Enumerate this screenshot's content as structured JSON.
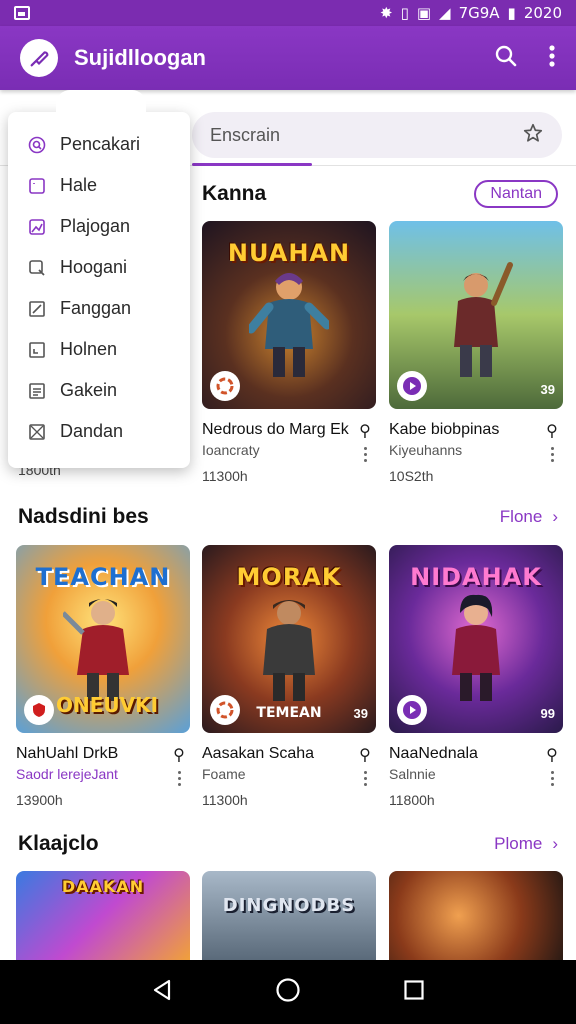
{
  "status_bar": {
    "signal_text": "7G9A",
    "time": "2020"
  },
  "app_bar": {
    "title": "Sujidlloogan",
    "search_icon": "search-icon",
    "menu_icon": "more-vert-icon",
    "logo_icon": "pen-nib-icon"
  },
  "search": {
    "placeholder": "Enscrain",
    "action_icon": "star-icon"
  },
  "dropdown": {
    "items": [
      {
        "label": "Pencakari",
        "icon": "search-circle-icon"
      },
      {
        "label": "Hale",
        "icon": "square-icon"
      },
      {
        "label": "Plajogan",
        "icon": "image-edit-icon"
      },
      {
        "label": "Hoogani",
        "icon": "search-icon"
      },
      {
        "label": "Fanggan",
        "icon": "edit-square-icon"
      },
      {
        "label": "Holnen",
        "icon": "layout-icon"
      },
      {
        "label": "Gakein",
        "icon": "document-icon"
      },
      {
        "label": "Dandan",
        "icon": "crossed-box-icon"
      }
    ]
  },
  "section1": {
    "title": "Kanna",
    "button": "Nantan",
    "cards": [
      {
        "art_title": "NUAHAN",
        "name": "Nedrous do Marg Ek",
        "sub": "Ioancraty",
        "time": "11300h",
        "count": "",
        "badge": "spin-icon"
      },
      {
        "art_title": "",
        "name": "Kabe biobpinas",
        "sub": "Kiyeuhanns",
        "time": "10S2th",
        "count": "39",
        "badge": "play-icon"
      }
    ],
    "hidden_card_time": "1800th"
  },
  "section2": {
    "title": "Nadsdini bes",
    "link": "Flone",
    "cards": [
      {
        "art_title": "TEACHAN",
        "name": "NahUahl DrkB",
        "sub": "Saodr lerejeJant",
        "sub_accent": true,
        "time": "13900h",
        "count": "",
        "badge": "shield-icon",
        "bottom_label": "ONEUVKI"
      },
      {
        "art_title": "MORAK",
        "name": "Aasakan Scaha",
        "sub": "Foame",
        "time": "11300h",
        "count": "39",
        "badge": "spin-icon",
        "bottom_label": "TEMEAN"
      },
      {
        "art_title": "NIDAHAK",
        "name": "NaaNednala",
        "sub": "Salnnie",
        "time": "11800h",
        "count": "99",
        "badge": "play-icon",
        "bottom_label": ""
      }
    ]
  },
  "section3": {
    "title": "Klaajclo",
    "link": "Plome",
    "cards": [
      {
        "art_title": "DAAKAN"
      },
      {
        "art_title": "DINGNODBS"
      },
      {
        "art_title": ""
      }
    ]
  },
  "nav": {
    "back": "back-triangle-icon",
    "home": "home-circle-icon",
    "recents": "recents-square-icon"
  },
  "colors": {
    "accent": "#8a37c4",
    "appbar": "#7a2db4"
  }
}
